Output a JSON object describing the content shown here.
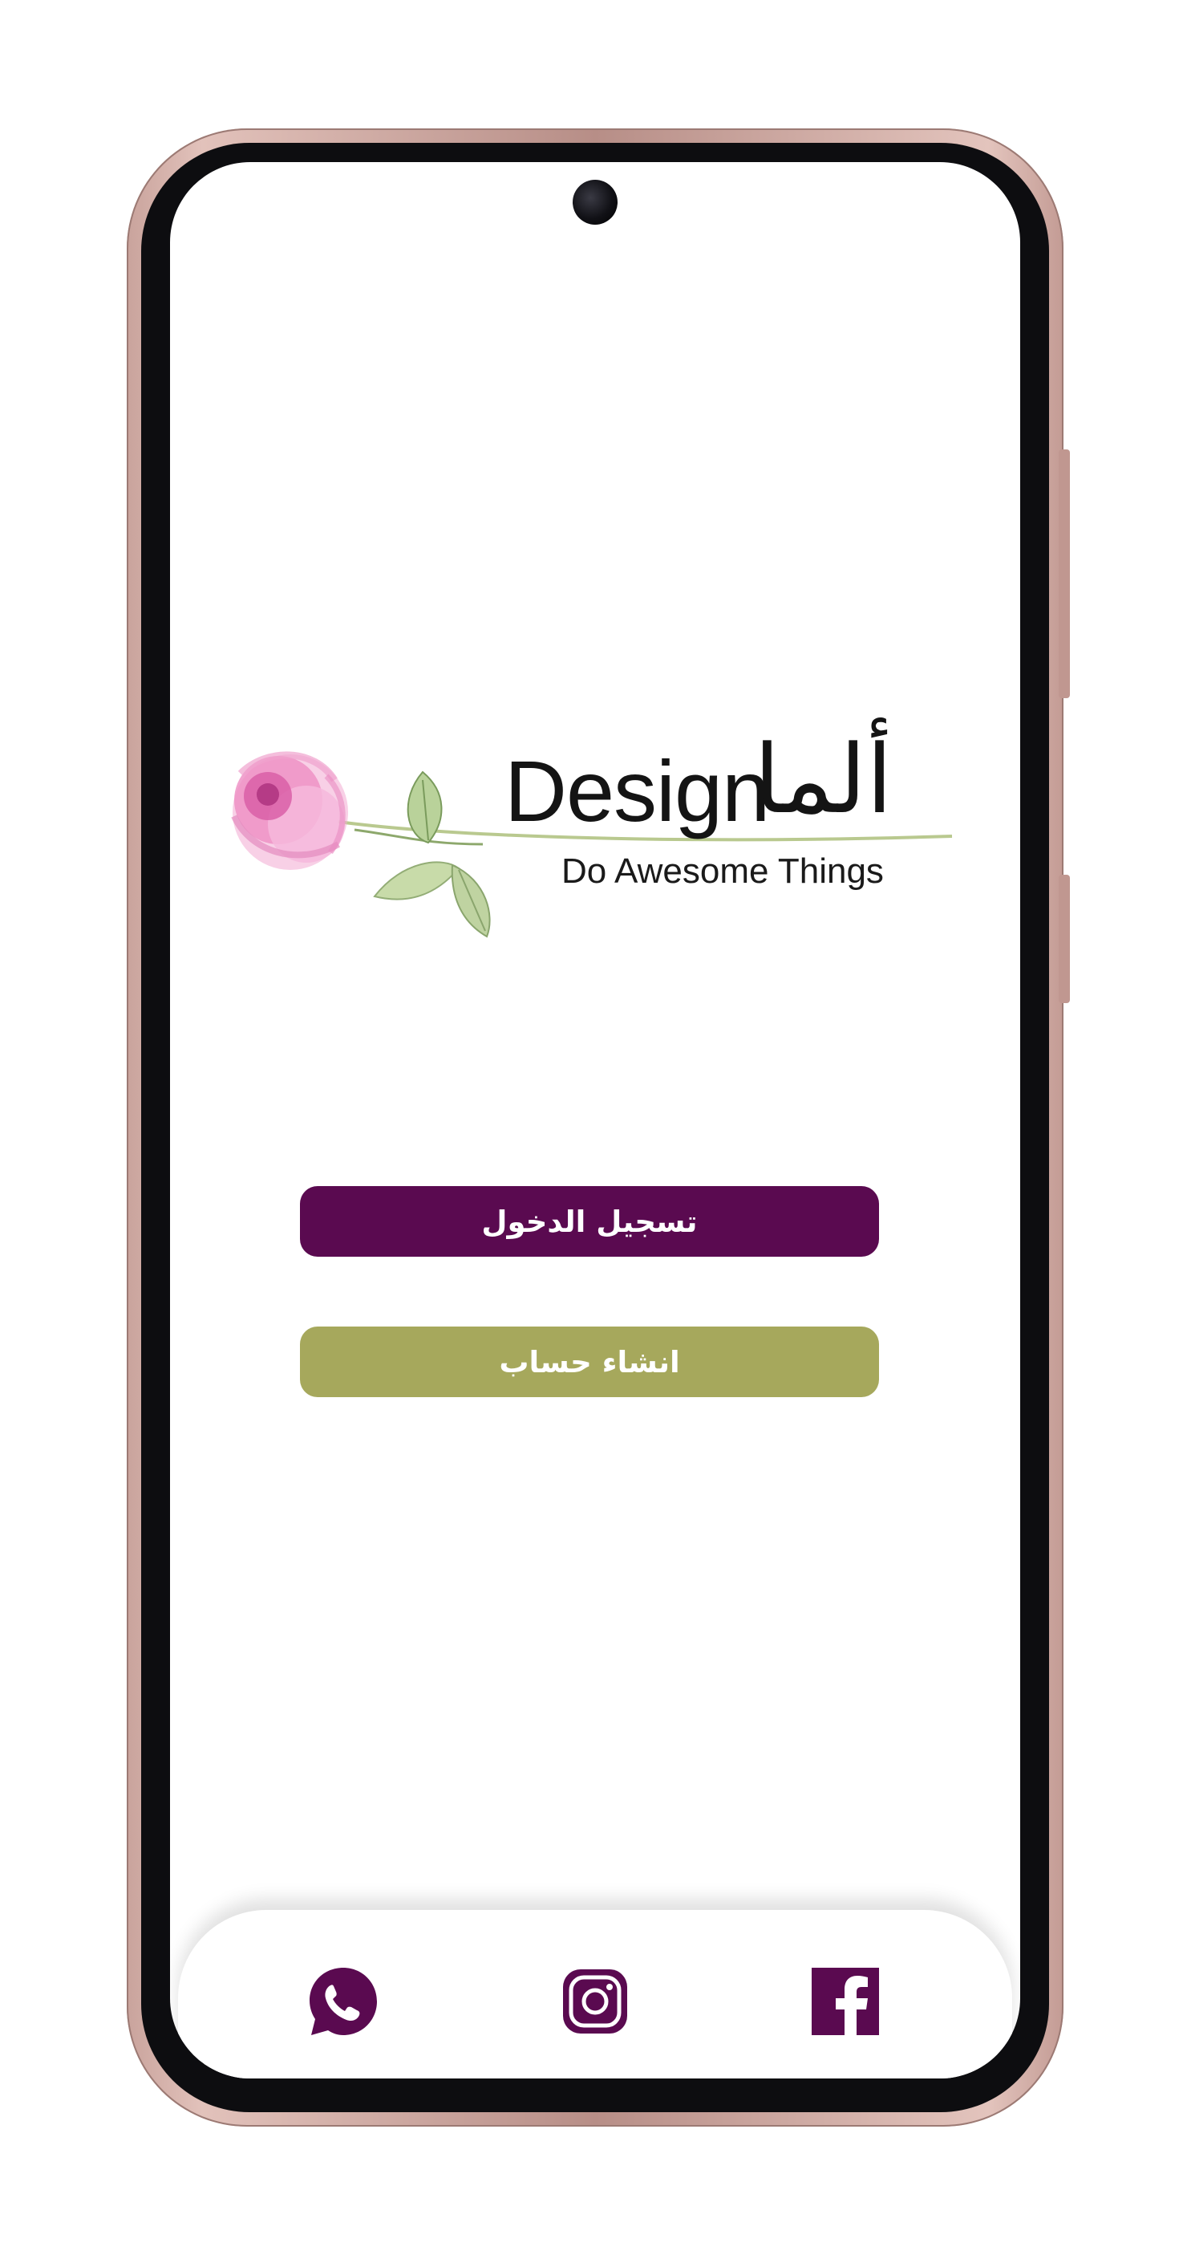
{
  "logo": {
    "wordmark": "Design",
    "arabic_mark": "ألما",
    "tagline": "Do Awesome Things",
    "icon": "rose-flower-icon"
  },
  "buttons": {
    "login_label": "تسجيل الدخول",
    "register_label": "انشاء حساب"
  },
  "social": {
    "items": [
      {
        "name": "whatsapp",
        "icon": "whatsapp-icon"
      },
      {
        "name": "instagram",
        "icon": "instagram-icon"
      },
      {
        "name": "facebook",
        "icon": "facebook-icon"
      }
    ]
  },
  "colors": {
    "primary": "#5a0a50",
    "secondary": "#a6a85c",
    "rose": "#e07bb8",
    "leaf": "#a9c98b",
    "frame": "#c9a39c"
  }
}
